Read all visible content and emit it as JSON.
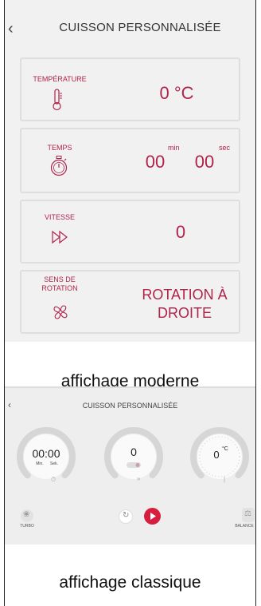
{
  "modern": {
    "back_icon": "chevron-left-icon",
    "title": "CUISSON PERSONNALISÉE",
    "accent": "#b0234a",
    "cards": {
      "temperature": {
        "label": "TEMPÉRATURE",
        "icon": "thermometer-icon",
        "value": "0 °C"
      },
      "time": {
        "label": "TEMPS",
        "icon": "stopwatch-icon",
        "minutes": "00",
        "min_unit": "min",
        "seconds": "00",
        "sec_unit": "sec"
      },
      "speed": {
        "label": "VITESSE",
        "icon": "fast-forward-icon",
        "value": "0"
      },
      "rotation": {
        "label_line1": "SENS DE",
        "label_line2": "ROTATION",
        "icon": "fan-icon",
        "value_line1": "ROTATION À",
        "value_line2": "DROITE"
      }
    },
    "caption": "affichage moderne"
  },
  "classic": {
    "back_icon": "chevron-left-icon",
    "title": "CUISSON PERSONNALISÉE",
    "time": {
      "value": "00:00",
      "min_label": "Min.",
      "sec_label": "Sek."
    },
    "speed": {
      "value": "0"
    },
    "temperature": {
      "value": "0",
      "unit": "°C"
    },
    "turbo_label": "TURBO",
    "balance_label": "BALANCE",
    "accent": "#d81e3f",
    "caption": "affichage classique"
  }
}
